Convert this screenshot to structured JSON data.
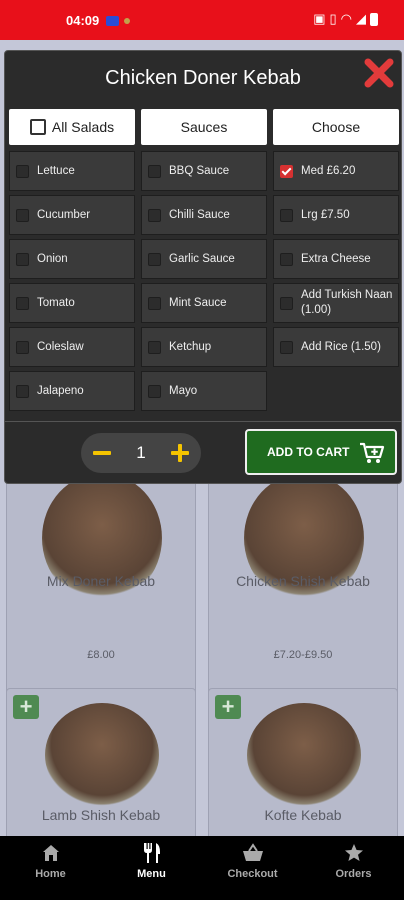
{
  "status_bar": {
    "time": "04:09",
    "icons": [
      "nfc-icon",
      "vibrate-icon",
      "wifi-icon",
      "signal-icon",
      "battery-icon"
    ]
  },
  "modal": {
    "title": "Chicken Doner Kebab",
    "tabs": {
      "all_salads": "All Salads",
      "sauces": "Sauces",
      "choose": "Choose"
    },
    "salads": [
      {
        "label": "Lettuce",
        "checked": false
      },
      {
        "label": "Cucumber",
        "checked": false
      },
      {
        "label": "Onion",
        "checked": false
      },
      {
        "label": "Tomato",
        "checked": false
      },
      {
        "label": "Coleslaw",
        "checked": false
      },
      {
        "label": "Jalapeno",
        "checked": false
      }
    ],
    "sauces": [
      {
        "label": "BBQ Sauce",
        "checked": false
      },
      {
        "label": "Chilli Sauce",
        "checked": false
      },
      {
        "label": "Garlic Sauce",
        "checked": false
      },
      {
        "label": "Mint Sauce",
        "checked": false
      },
      {
        "label": "Ketchup",
        "checked": false
      },
      {
        "label": "Mayo",
        "checked": false
      }
    ],
    "choose": [
      {
        "label": "Med £6.20",
        "checked": true
      },
      {
        "label": "Lrg £7.50",
        "checked": false
      },
      {
        "label": "Extra Cheese",
        "checked": false
      },
      {
        "label": "Add Turkish Naan (1.00)",
        "checked": false
      },
      {
        "label": "Add Rice (1.50)",
        "checked": false
      }
    ],
    "quantity": "1",
    "add_to_cart": "ADD TO CART",
    "colors": {
      "accent": "#f5c400",
      "cart_green": "#1f6b1f",
      "close_red": "#e23b3b",
      "check_red": "#d63131"
    }
  },
  "menu_items": [
    {
      "name": "Mix Doner Kebab",
      "price": "£8.00"
    },
    {
      "name": "Chicken Shish Kebab",
      "price": "£7.20-£9.50"
    },
    {
      "name": "Lamb Shish Kebab",
      "price": ""
    },
    {
      "name": "Kofte Kebab",
      "price": ""
    }
  ],
  "bottom_nav": [
    {
      "label": "Home",
      "icon": "home-icon",
      "active": false
    },
    {
      "label": "Menu",
      "icon": "fork-knife-icon",
      "active": true
    },
    {
      "label": "Checkout",
      "icon": "basket-icon",
      "active": false
    },
    {
      "label": "Orders",
      "icon": "star-icon",
      "active": false
    }
  ]
}
